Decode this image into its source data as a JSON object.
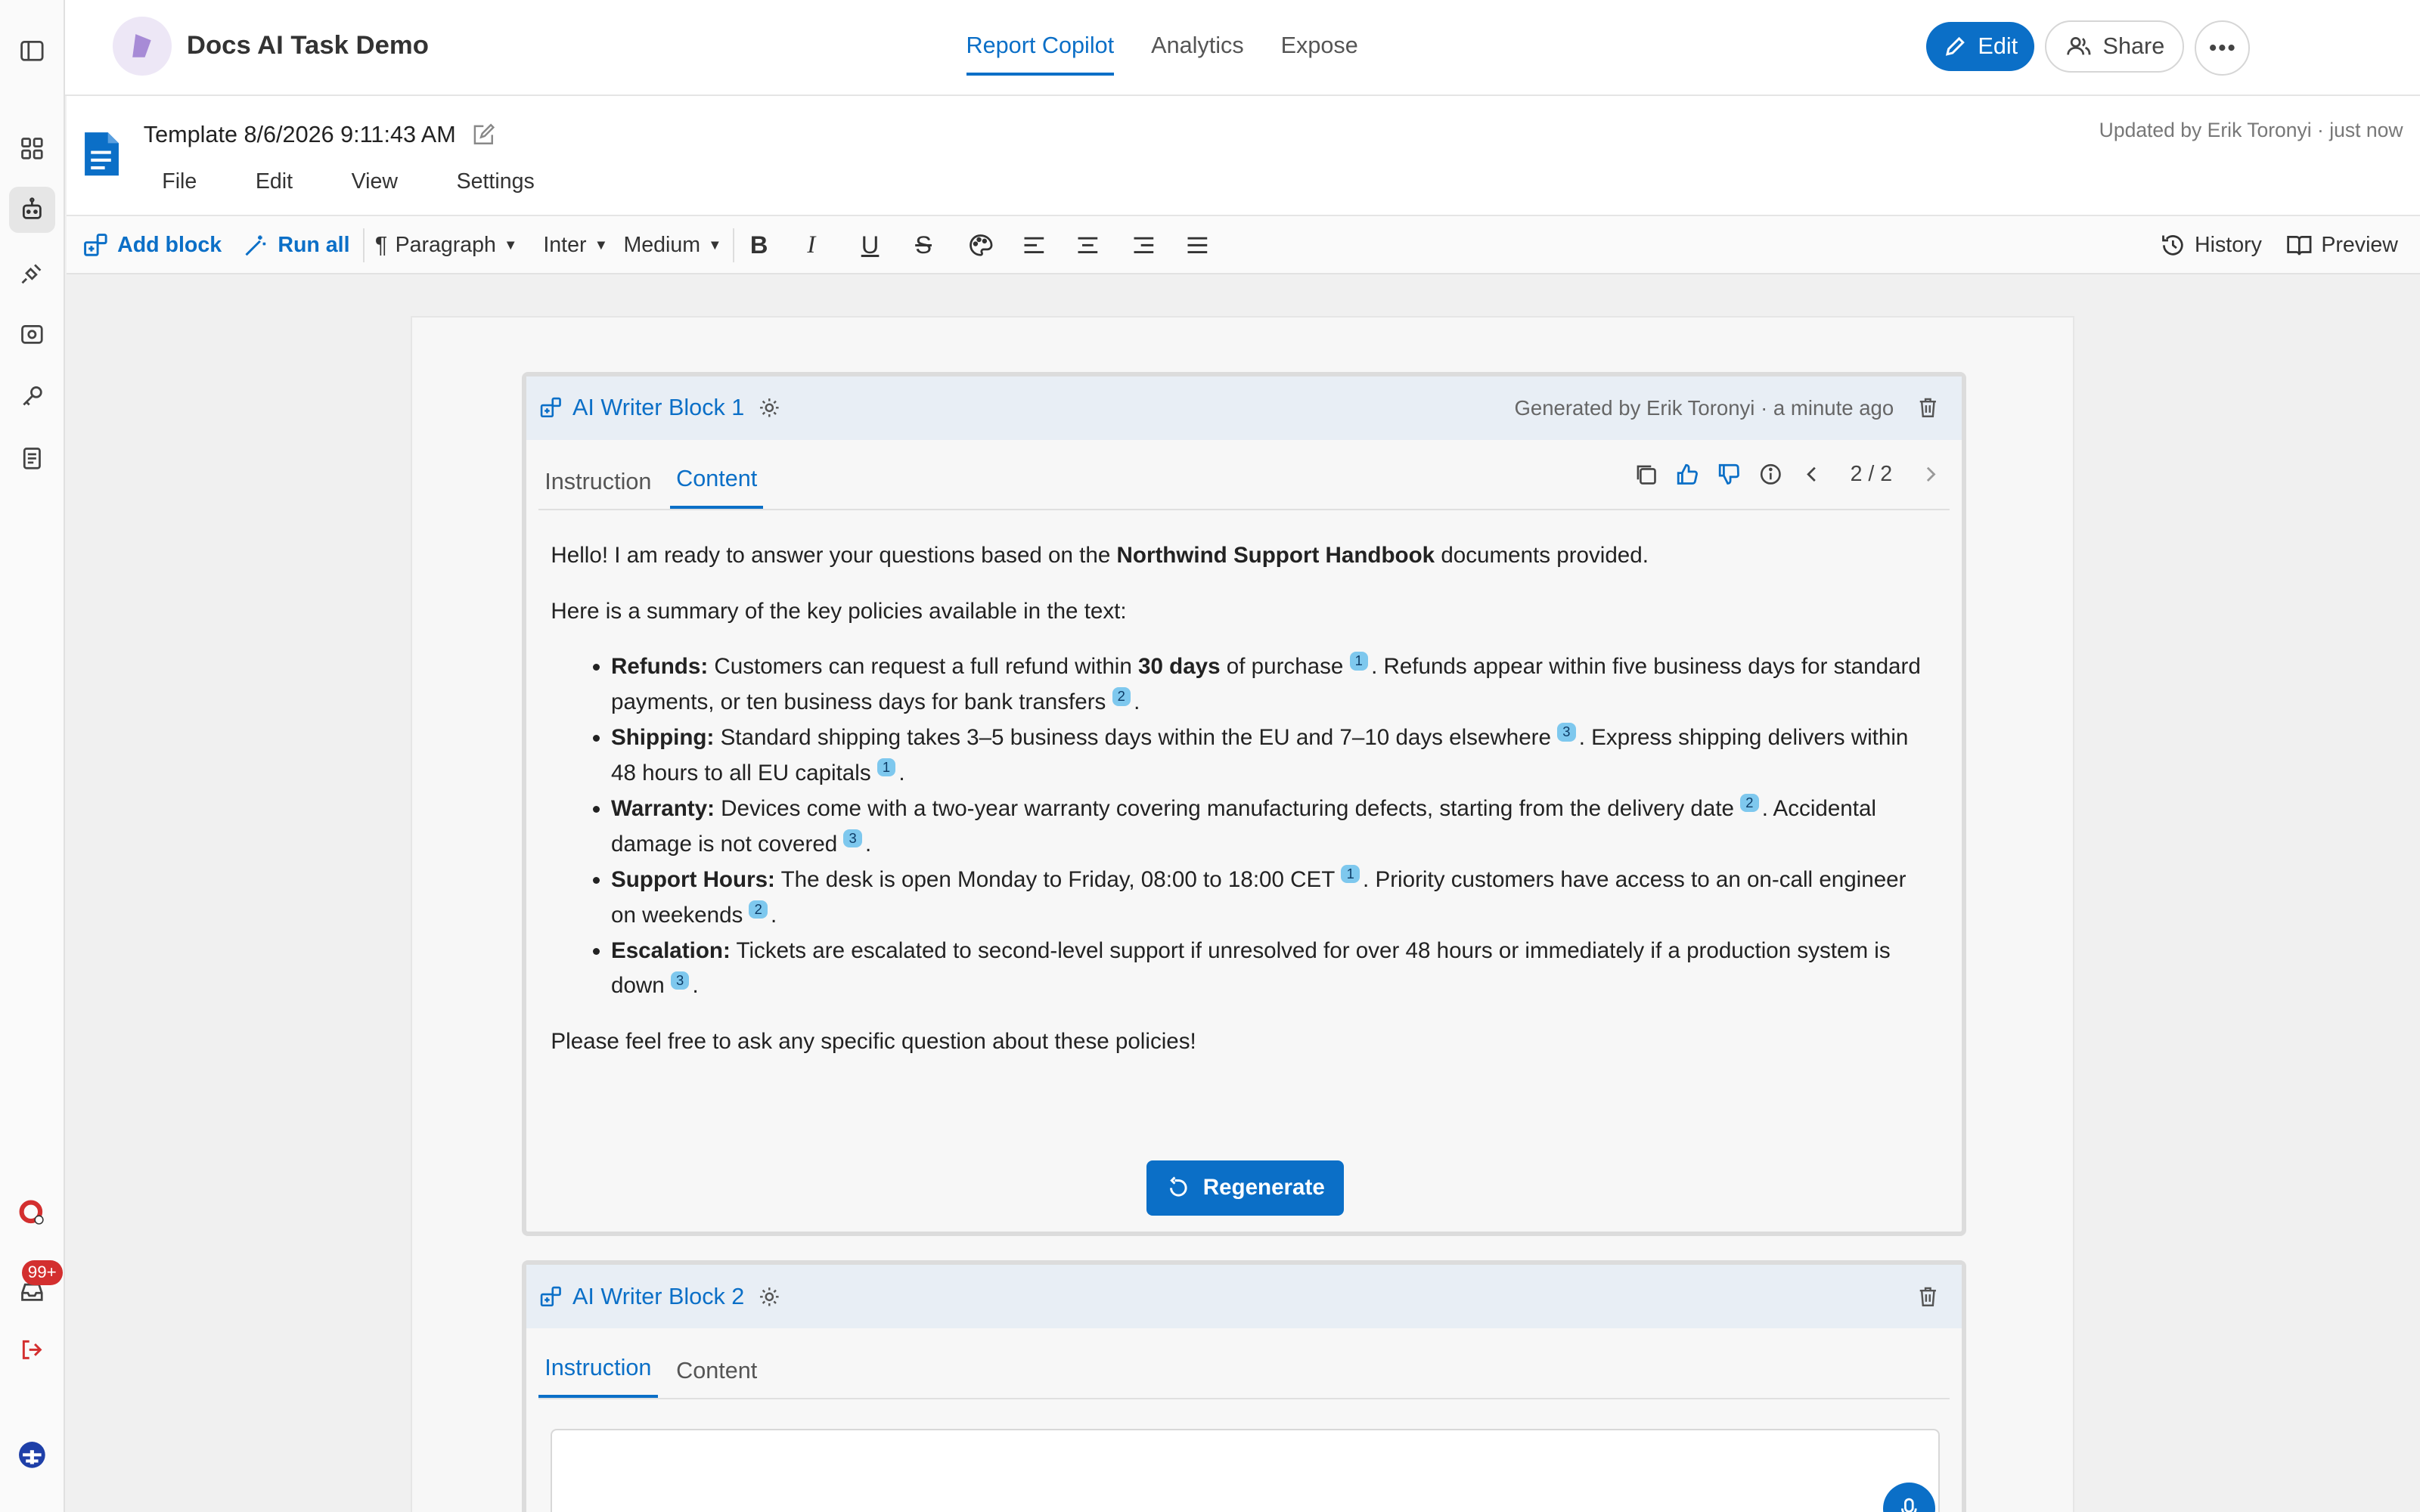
{
  "app": {
    "title": "Docs AI Task Demo"
  },
  "nav": {
    "tabs": [
      "Report Copilot",
      "Analytics",
      "Expose"
    ],
    "active": "Report Copilot"
  },
  "header": {
    "edit_label": "Edit",
    "share_label": "Share"
  },
  "rail": {
    "notification_badge": "99+"
  },
  "doc": {
    "title": "Template 8/6/2026 9:11:43 AM",
    "menus": [
      "File",
      "Edit",
      "View",
      "Settings"
    ],
    "updated": "Updated by Erik Toronyi · just now"
  },
  "toolbar": {
    "add_block": "Add block",
    "run_all": "Run all",
    "paragraph": "Paragraph",
    "font": "Inter",
    "weight": "Medium",
    "history": "History",
    "preview": "Preview"
  },
  "block1": {
    "title": "AI Writer Block 1",
    "meta": "Generated by Erik Toronyi · a minute ago",
    "tabs": [
      "Instruction",
      "Content"
    ],
    "active_tab": "Content",
    "pager": "2 / 2",
    "intro_a": "Hello! I am ready to answer your questions based on the ",
    "intro_bold": "Northwind Support Handbook",
    "intro_b": " documents provided.",
    "summary": "Here is a summary of the key policies available in the text:",
    "items": [
      {
        "label": "Refunds:",
        "t1": " Customers can request a full refund within ",
        "bold": "30 days",
        "t2": " of purchase",
        "c1": "1",
        "t3": ". Refunds appear within five business days for standard payments, or ten business days for bank transfers",
        "c2": "2",
        "t4": "."
      },
      {
        "label": "Shipping:",
        "t1": " Standard shipping takes 3–5 business days within the EU and 7–10 days elsewhere",
        "c1": "3",
        "t3": ". Express shipping delivers within 48 hours to all EU capitals",
        "c2": "1",
        "t4": "."
      },
      {
        "label": "Warranty:",
        "t1": " Devices come with a two-year warranty covering manufacturing defects, starting from the delivery date",
        "c1": "2",
        "t3": ". Accidental damage is not covered",
        "c2": "3",
        "t4": "."
      },
      {
        "label": "Support Hours:",
        "t1": " The desk is open Monday to Friday, 08:00 to 18:00 CET",
        "c1": "1",
        "t3": ". Priority customers have access to an on-call engineer on weekends",
        "c2": "2",
        "t4": "."
      },
      {
        "label": "Escalation:",
        "t1": " Tickets are escalated to second-level support if unresolved for over 48 hours or immediately if a production system is down",
        "c1": "3",
        "t4": "."
      }
    ],
    "closing": "Please feel free to ask any specific question about these policies!",
    "regenerate": "Regenerate"
  },
  "block2": {
    "title": "AI Writer Block 2",
    "tabs": [
      "Instruction",
      "Content"
    ],
    "active_tab": "Instruction"
  },
  "colors": {
    "accent": "#0b6fc7",
    "citation": "#7ec8ee",
    "badge": "#d32f2f"
  }
}
